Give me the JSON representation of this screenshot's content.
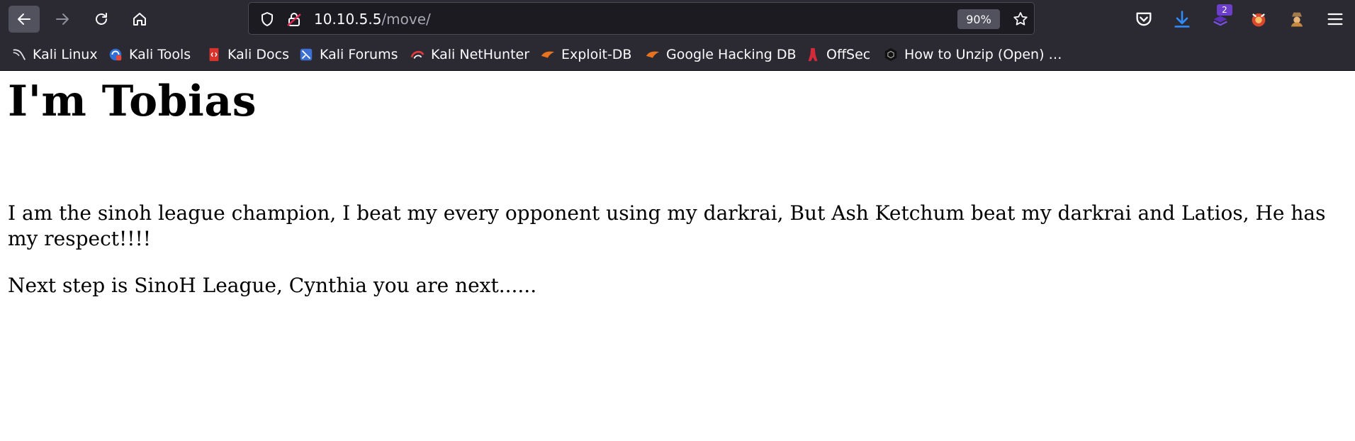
{
  "browser": {
    "url_host": "10.10.5.5",
    "url_path": "/move/",
    "zoom": "90%",
    "extension_badge": "2",
    "icons": [
      "back-arrow-icon",
      "forward-arrow-icon",
      "reload-icon",
      "home-icon",
      "shield-icon",
      "lock-icon",
      "star-icon",
      "pocket-icon",
      "download-icon",
      "extension-icon",
      "extension-icon-2",
      "extension-icon-3",
      "menu-icon"
    ]
  },
  "bookmarks": [
    {
      "label": "Kali Linux"
    },
    {
      "label": "Kali Tools"
    },
    {
      "label": "Kali Docs"
    },
    {
      "label": "Kali Forums"
    },
    {
      "label": "Kali NetHunter"
    },
    {
      "label": "Exploit-DB"
    },
    {
      "label": "Google Hacking DB"
    },
    {
      "label": "OffSec"
    },
    {
      "label": "How to Unzip (Open) …"
    }
  ],
  "page": {
    "heading": "I'm Tobias",
    "paragraph1": "I am the sinoh league champion, I beat my every opponent using my darkrai, But Ash Ketchum beat my darkrai and Latios, He has my respect!!!!",
    "paragraph2": "Next step is SinoH League, Cynthia you are next......"
  },
  "colors": {
    "toolbar_bg": "#2b2a33",
    "urlbar_bg": "#1c1b22",
    "text_light": "#fbfbfe",
    "page_bg": "#ffffff"
  }
}
